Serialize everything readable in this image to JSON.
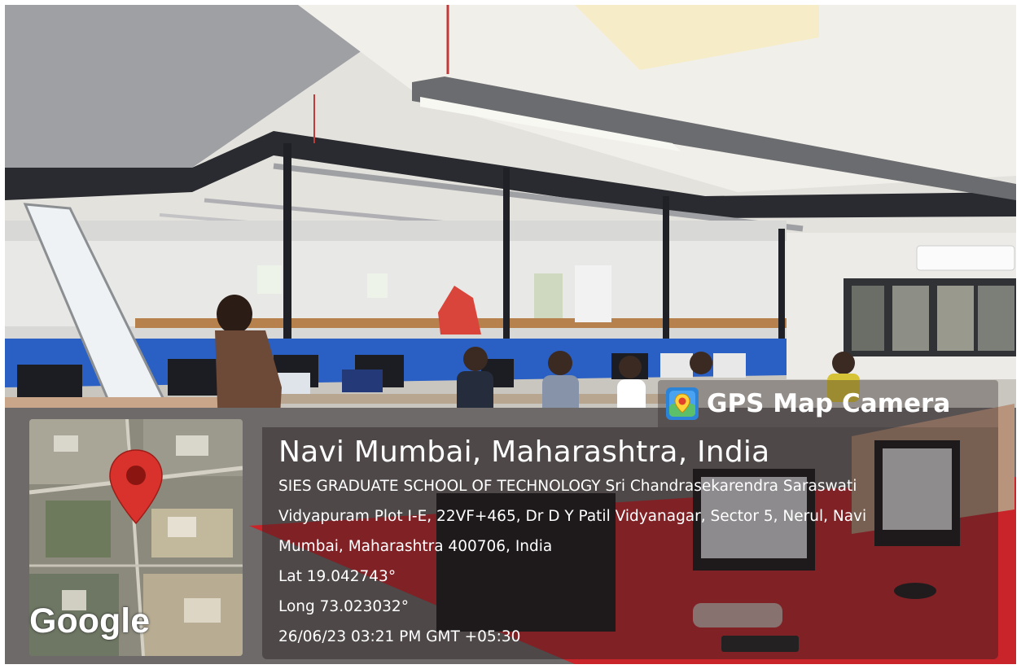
{
  "badge": {
    "icon": "gps-map-pin-icon",
    "label": "GPS Map Camera"
  },
  "location": {
    "title": "Navi Mumbai, Maharashtra, India",
    "address_line_1": "SIES GRADUATE SCHOOL OF TECHNOLOGY Sri Chandrasekarendra Saraswati",
    "address_line_2": "Vidyapuram Plot I-E, 22VF+465, Dr D Y Patil Vidyanagar, Sector 5, Nerul, Navi",
    "address_line_3": "Mumbai, Maharashtra 400706, India",
    "latitude": "Lat 19.042743°",
    "longitude": "Long 73.023032°",
    "timestamp": "26/06/23 03:21 PM GMT +05:30"
  },
  "map": {
    "provider": "Google",
    "marker_icon": "location-marker-icon",
    "marker_color": "#d9322c"
  },
  "colors": {
    "wall_blue": "#2a5fc4",
    "desk_red": "#c8242a",
    "overlay_text": "#ffffff"
  }
}
